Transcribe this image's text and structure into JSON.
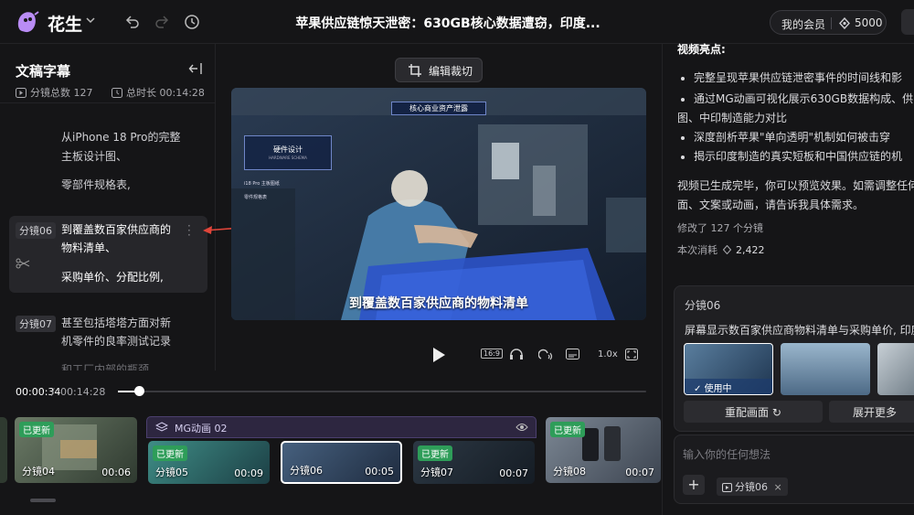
{
  "app": {
    "brand": "花生"
  },
  "header": {
    "title": "苹果供应链惊天泄密：630GB核心数据遭窃，印度...",
    "member_label": "我的会员",
    "coins": "5000"
  },
  "left_panel": {
    "title": "文稿字幕",
    "segment_count_label": "分镜总数 127",
    "total_duration_label": "总时长 00:14:28",
    "lines": [
      {
        "text": "从iPhone 18 Pro的完整"
      },
      {
        "text": "主板设计图、"
      },
      {
        "text": "零部件规格表,"
      }
    ],
    "active_segment": {
      "tag": "分镜06",
      "line1": "到覆盖数百家供应商的",
      "line2": "物料清单、",
      "line3": "采购单价、分配比例,"
    },
    "next_segment": {
      "tag": "分镜07",
      "line1": "甚至包括塔塔方面对新",
      "line2": "机零件的良率测试记录",
      "line3": "和工厂内部的瓶颈..."
    }
  },
  "editor": {
    "edit_crop_label": "编辑裁切",
    "video_overlay": {
      "banner": "核心商业资产泄露",
      "card_title": "硬件设计",
      "card_sub": "HARDWARE SCHEMA",
      "item1": "i18 Pro 主板图纸",
      "item2": "零件规格表"
    },
    "subtitle": "到覆盖数百家供应商的物料清单",
    "controls": {
      "ratio": "16:9",
      "speed": "1.0x"
    },
    "progress": {
      "current": "00:00:34",
      "separator": "/",
      "total": "00:14:28",
      "fraction": 0.04
    }
  },
  "timeline": {
    "group_label": "MG动画 02",
    "clips": [
      {
        "name": "分镜04",
        "duration": "00:06",
        "badge": "已更新"
      },
      {
        "name": "分镜05",
        "duration": "00:09",
        "badge": "已更新"
      },
      {
        "name": "分镜06",
        "duration": "00:05",
        "badge": ""
      },
      {
        "name": "分镜07",
        "duration": "00:07",
        "badge": "已更新"
      },
      {
        "name": "分镜08",
        "duration": "00:07",
        "badge": "已更新"
      }
    ]
  },
  "right_panel": {
    "highlights_title": "视频亮点:",
    "bullets": [
      "完整呈现苹果供应链泄密事件的时间线和影",
      "通过MG动画可视化展示630GB数据构成、供",
      "图、中印制造能力对比",
      "深度剖析苹果\"单向透明\"机制如何被击穿",
      "揭示印度制造的真实短板和中国供应链的机"
    ],
    "message_line1": "视频已生成完毕，你可以预览效果。如需调整任何",
    "message_line2": "面、文案或动画，请告诉我具体需求。",
    "modified": "修改了 127 个分镜",
    "cost_label": "本次消耗",
    "cost_value": "2,422",
    "card": {
      "title": "分镜06",
      "desc": "屏幕显示数百家供应商物料清单与采购单价, 印度",
      "in_use": "使用中",
      "rematch": "重配画面",
      "expand": "展开更多"
    },
    "input_placeholder": "输入你的任何想法",
    "chip": "分镜06"
  },
  "colors": {
    "badge_green": "#2e9d59",
    "accent_purple": "#4b3f6e",
    "arrow_red": "#e0453a"
  }
}
